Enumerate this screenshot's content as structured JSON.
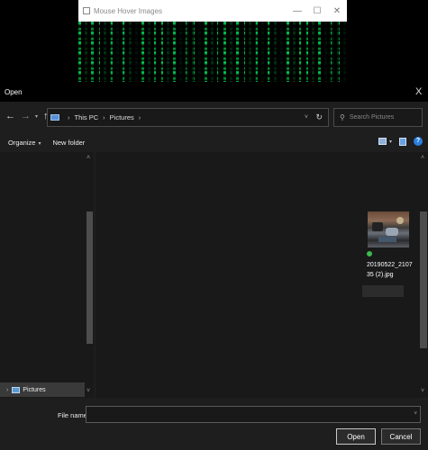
{
  "background_window": {
    "title": "Mouse Hover Images",
    "minimize": "—",
    "maximize": "☐",
    "close": "✕"
  },
  "dialog": {
    "title": "Open",
    "close": "X"
  },
  "navigation": {
    "back": "←",
    "forward": "→",
    "recent": "▾",
    "up": "↑",
    "breadcrumb": [
      "This PC",
      "Pictures"
    ],
    "separator": "›",
    "address_dropdown": "˅",
    "refresh": "↻",
    "search_placeholder": "Search Pictures",
    "search_icon": "⚲"
  },
  "toolbar": {
    "organize": "Organize",
    "organize_caret": "▾",
    "new_folder": "New folder",
    "view_caret": "▾",
    "help": "?"
  },
  "nav_pane": {
    "items": [
      {
        "label": "Pictures",
        "expand": "›",
        "icon": "pictures-folder-icon"
      }
    ],
    "scroll_up": "˄",
    "scroll_down": "˅"
  },
  "content": {
    "scroll_up": "˄",
    "scroll_down": "˅",
    "files": [
      {
        "name_line1": "20190522_2107",
        "name_line2": "35 (2).jpg",
        "icon": "image-thumbnail"
      }
    ]
  },
  "footer": {
    "file_name_label": "File name:",
    "file_name_value": "",
    "file_name_dropdown": "˅",
    "open_button": "Open",
    "cancel_button": "Cancel"
  }
}
